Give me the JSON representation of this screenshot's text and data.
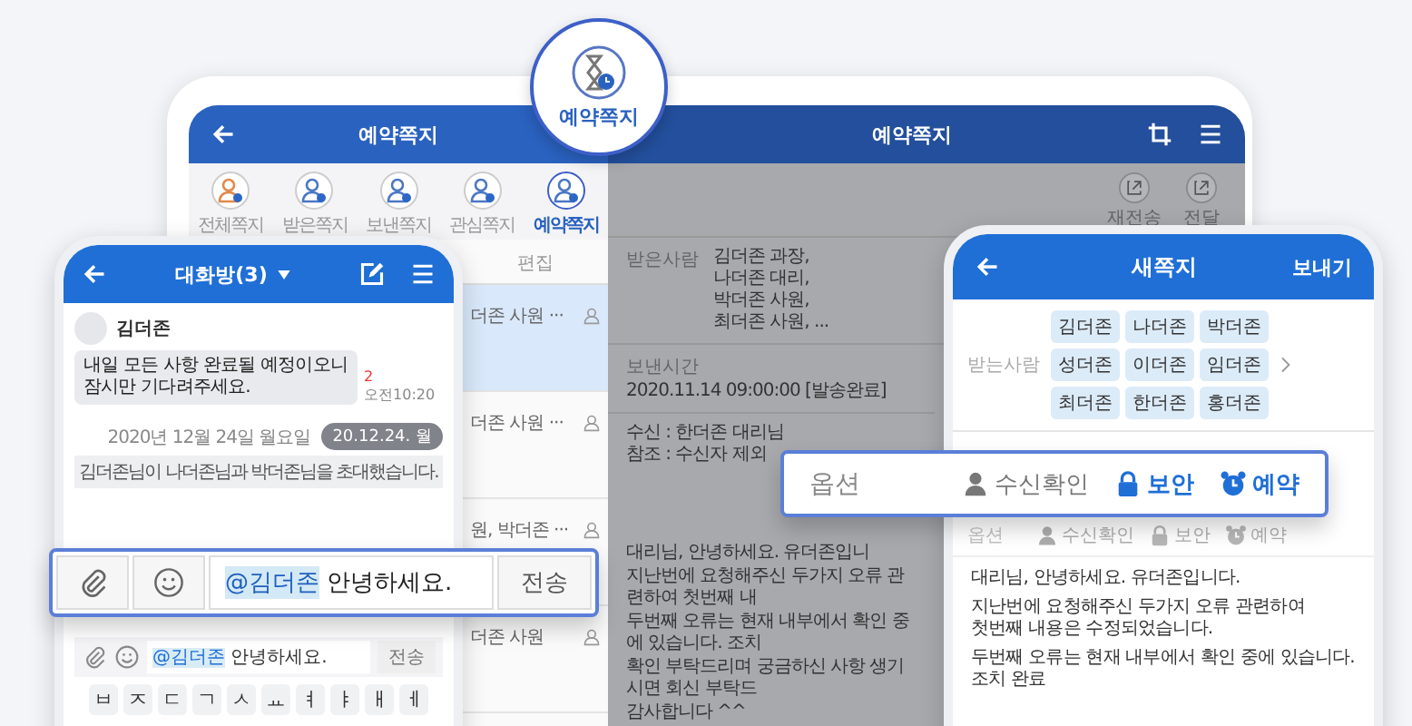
{
  "badge": {
    "label": "예약쪽지"
  },
  "tablet": {
    "title": "예약쪽지",
    "tabs": [
      {
        "label": "전체쪽지",
        "selected": false
      },
      {
        "label": "받은쪽지",
        "selected": false
      },
      {
        "label": "보낸쪽지",
        "selected": false
      },
      {
        "label": "관심쪽지",
        "selected": false
      },
      {
        "label": "예약쪽지",
        "selected": true
      }
    ],
    "edit": "편집",
    "rows": [
      {
        "text": "더존 사원 ···",
        "selected": true
      },
      {
        "text": "더존 사원 ···",
        "selected": false
      },
      {
        "text": "원, 박더존 ···",
        "selected": false
      },
      {
        "text": "더존 사원",
        "selected": false
      }
    ],
    "detail": {
      "title": "예약쪽지",
      "actions": [
        "재전송",
        "전달"
      ],
      "recipients_label": "받은사람",
      "recipients": [
        "김더존 과장,",
        "나더존 대리,",
        "박더존 사원,",
        "최더존 사원, ..."
      ],
      "sent_label": "보낸시간",
      "sent_value": "2020.11.14 09:00:00 [발송완료]",
      "to": "수신 : 한더존 대리님",
      "cc": "참조 : 수신자 제외",
      "body": [
        "대리님, 안녕하세요. 유더존입니",
        "지난번에 요청해주신 두가지 오류 관련하여 첫번째 내",
        "두번째 오류는 현재 내부에서 확인 중에 있습니다. 조치",
        "확인 부탁드리며 궁금하신 사항 생기시면 회신 부탁드",
        "감사합니다 ^^"
      ]
    }
  },
  "chat": {
    "title": "대화방(3)",
    "sender": "김더존",
    "message": "내일 모든 사항 완료될 예정이오니\n잠시만 기다려주세요.",
    "unread": "2",
    "time": "오전10:20",
    "date": "2020년 12월 24일 월요일",
    "date_pill": "20.12.24. 월",
    "notice": "김더존님이 나더존님과 박더존님을 초대했습니다.",
    "input": {
      "mention": "@김더존",
      "text": "안녕하세요."
    },
    "send": "전송",
    "keys": [
      "ㅂ",
      "ㅈ",
      "ㄷ",
      "ㄱ",
      "ㅅ",
      "ㅛ",
      "ㅕ",
      "ㅑ",
      "ㅐ",
      "ㅔ"
    ]
  },
  "chat_callout": {
    "input": {
      "mention": "@김더존",
      "text": "안녕하세요."
    },
    "send": "전송"
  },
  "compose": {
    "title": "새쪽지",
    "send": "보내기",
    "recipients_label": "받는사람",
    "chips": [
      "김더존",
      "나더존",
      "박더존",
      "성더존",
      "이더존",
      "임더존",
      "최더존",
      "한더존",
      "홍더존"
    ],
    "options_label": "옵션",
    "options": [
      {
        "kind": "receipt",
        "label": "수신확인",
        "on": false
      },
      {
        "kind": "security",
        "label": "보안",
        "on": false
      },
      {
        "kind": "schedule",
        "label": "예약",
        "on": false
      }
    ],
    "body": [
      "대리님, 안녕하세요. 유더존입니다.",
      "지난번에 요청해주신 두가지 오류 관련하여\n첫번째 내용은 수정되었습니다.",
      "두번째 오류는 현재 내부에서 확인 중에 있습니다. 조치 완료"
    ]
  },
  "options_callout": {
    "label": "옵션",
    "options": [
      {
        "kind": "receipt",
        "label": "수신확인",
        "on": false
      },
      {
        "kind": "security",
        "label": "보안",
        "on": true
      },
      {
        "kind": "schedule",
        "label": "예약",
        "on": true
      }
    ]
  }
}
